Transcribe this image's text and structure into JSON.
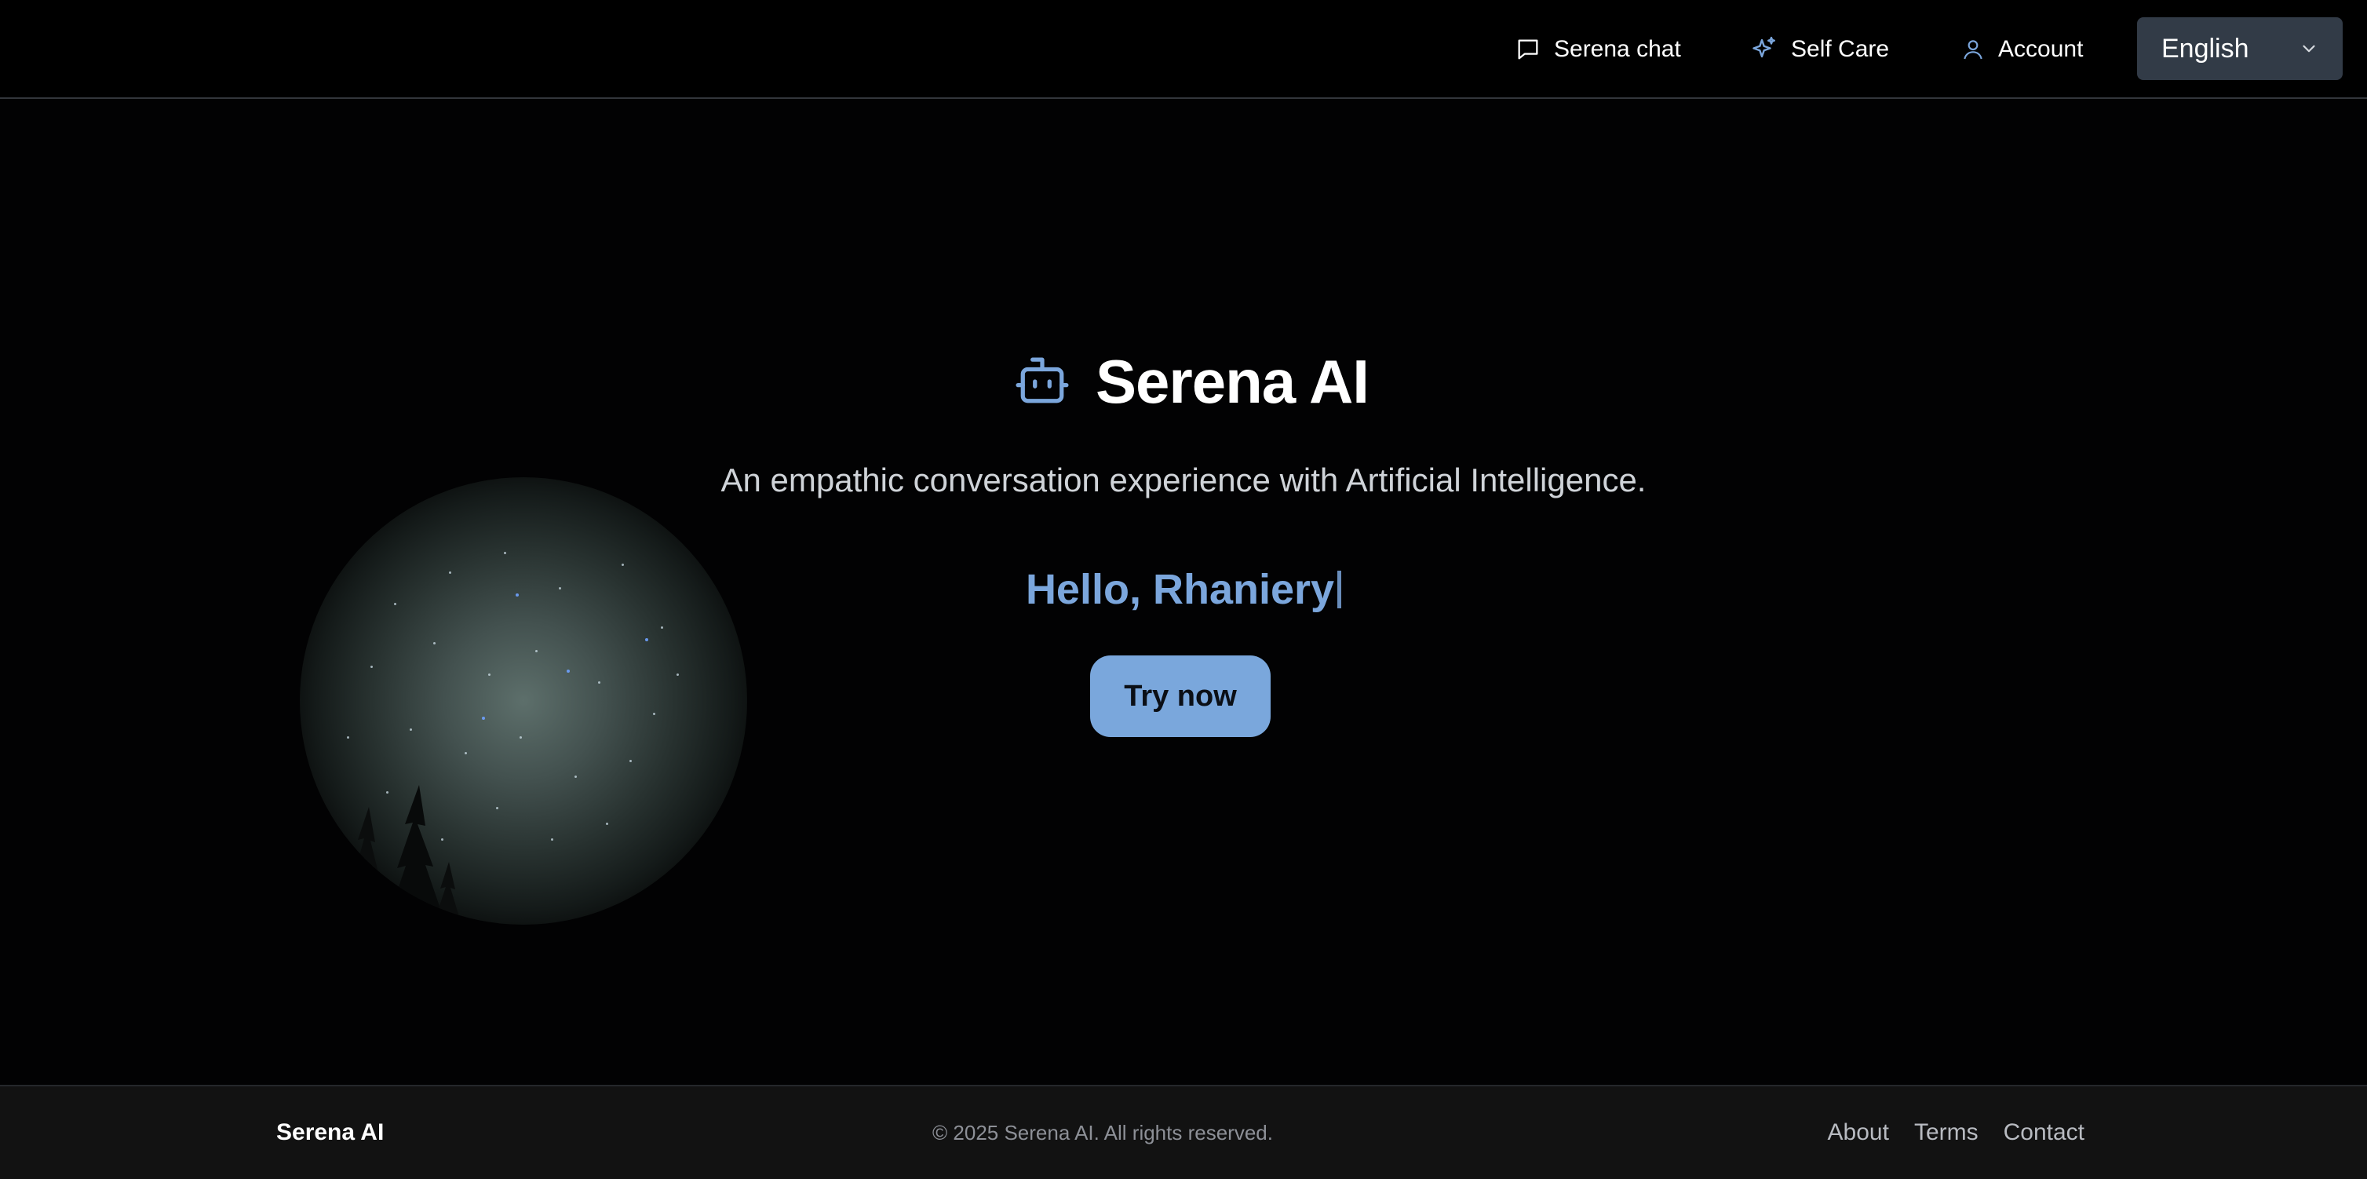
{
  "header": {
    "nav": [
      {
        "label": "Serena chat",
        "icon": "chat-bubble-icon"
      },
      {
        "label": "Self Care",
        "icon": "sparkles-icon"
      },
      {
        "label": "Account",
        "icon": "user-icon"
      }
    ],
    "language": {
      "selected": "English",
      "icon": "chevron-down-icon"
    }
  },
  "hero": {
    "title": "Serena AI",
    "logo_icon": "robot-icon",
    "tagline": "An empathic conversation experience with Artificial Intelligence.",
    "greeting": "Hello, Rhaniery",
    "cta_label": "Try now"
  },
  "footer": {
    "brand": "Serena AI",
    "copyright": "© 2025 Serena AI. All rights reserved.",
    "links": [
      "About",
      "Terms",
      "Contact"
    ]
  },
  "colors": {
    "accent": "#7aa7dc",
    "background": "#020203",
    "footer_bg": "#121212",
    "select_bg": "#323b47"
  }
}
